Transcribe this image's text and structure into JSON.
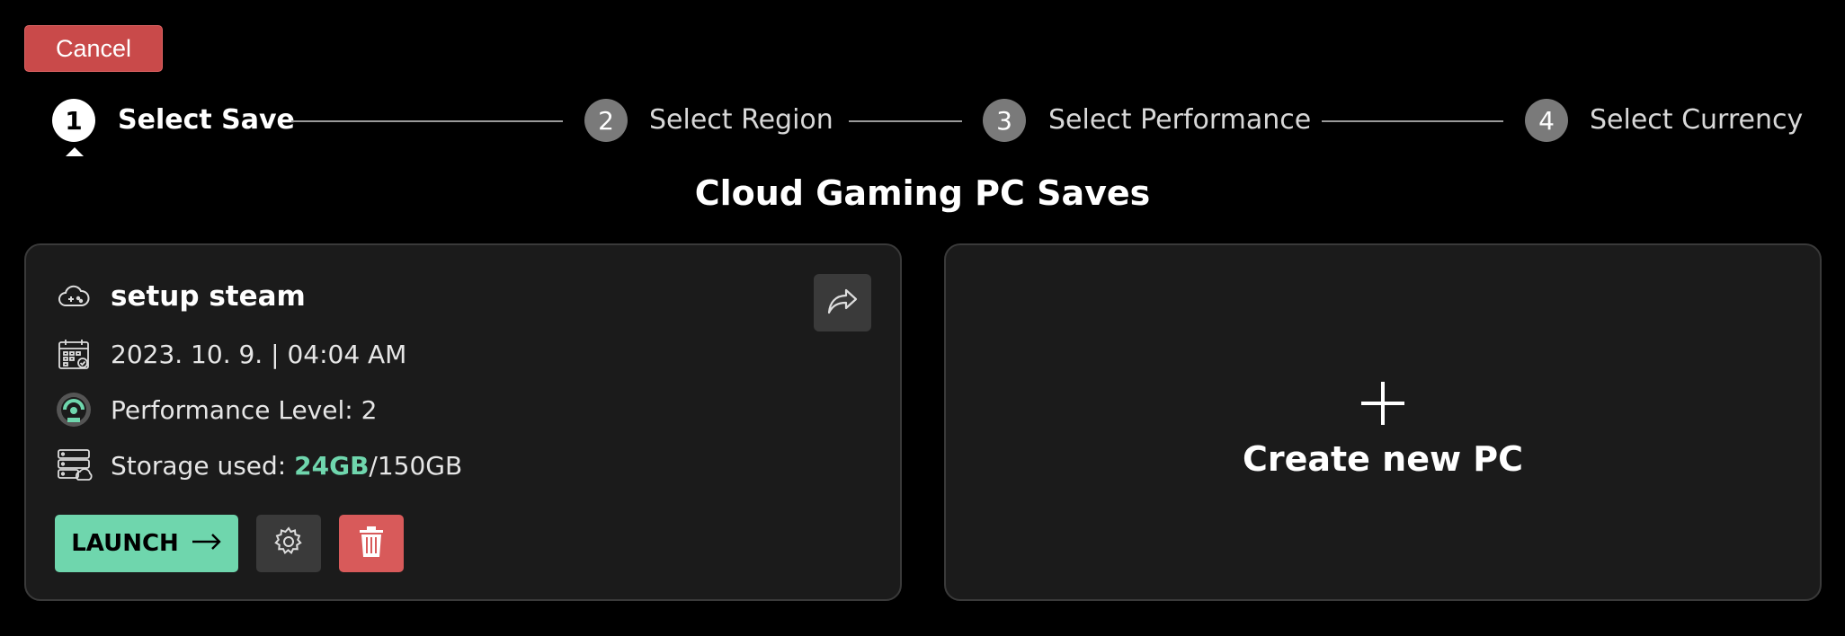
{
  "header": {
    "cancel_label": "Cancel"
  },
  "stepper": {
    "steps": [
      {
        "number": "1",
        "label": "Select Save",
        "state": "active"
      },
      {
        "number": "2",
        "label": "Select Region",
        "state": "inactive"
      },
      {
        "number": "3",
        "label": "Select Performance",
        "state": "inactive"
      },
      {
        "number": "4",
        "label": "Select Currency",
        "state": "inactive"
      }
    ]
  },
  "main": {
    "title": "Cloud Gaming PC Saves",
    "save_card": {
      "name": "setup steam",
      "datetime": "2023. 10. 9. | 04:04 AM",
      "performance": "Performance Level: 2",
      "storage_prefix": "Storage used: ",
      "storage_used": "24GB",
      "storage_total": "/150GB",
      "launch_label": "LAUNCH",
      "icons": [
        "cloud-game-icon",
        "calendar-icon",
        "speedometer-icon",
        "server-storage-icon",
        "share-arrow-icon",
        "gear-icon",
        "trash-icon",
        "arrow-right-icon"
      ]
    },
    "create_card": {
      "label": "Create new PC",
      "icon": "plus-icon"
    }
  },
  "colors": {
    "accent_green": "#6fd6ad",
    "danger_red": "#c94a4a",
    "card_bg": "#1b1b1b",
    "background": "#000000"
  }
}
